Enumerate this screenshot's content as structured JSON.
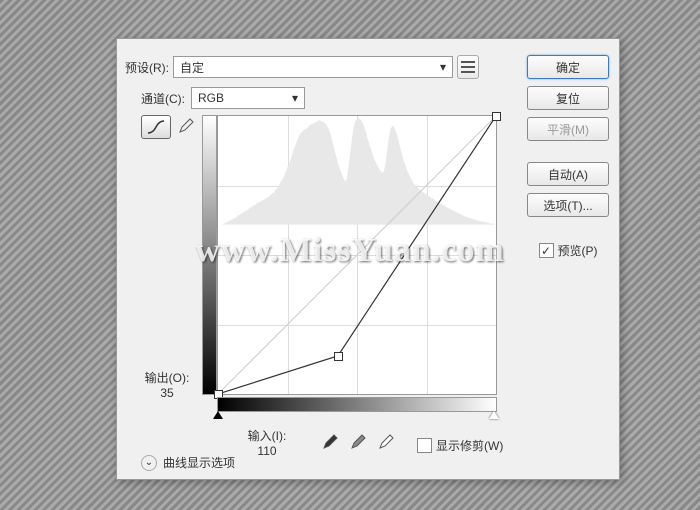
{
  "preset": {
    "label": "预设(R):",
    "value": "自定"
  },
  "channel": {
    "label": "通道(C):",
    "value": "RGB"
  },
  "output": {
    "label": "输出(O):",
    "value": "35"
  },
  "input": {
    "label": "输入(I):",
    "value": "110"
  },
  "clip": {
    "label": "显示修剪(W)",
    "checked": false
  },
  "disclosure": "曲线显示选项",
  "buttons": {
    "ok": "确定",
    "reset": "复位",
    "smooth": "平滑(M)",
    "auto": "自动(A)",
    "options": "选项(T)..."
  },
  "preview": {
    "label": "预览(P)",
    "checked": true
  },
  "icons": {
    "curve": "curve-tool-icon",
    "pencil": "pencil-tool-icon",
    "menu": "preset-menu-icon",
    "dropB": "black-point-dropper",
    "dropG": "gray-point-dropper",
    "dropW": "white-point-dropper"
  },
  "watermark": "www.MissYuan.com",
  "chart_data": {
    "type": "curve",
    "xlim": [
      0,
      255
    ],
    "ylim": [
      0,
      255
    ],
    "points": [
      {
        "x": 0,
        "y": 0
      },
      {
        "x": 110,
        "y": 35
      },
      {
        "x": 255,
        "y": 255
      }
    ],
    "histogram": [
      0,
      0,
      0,
      0,
      0,
      1,
      1,
      2,
      2,
      3,
      3,
      4,
      4,
      5,
      5,
      6,
      6,
      7,
      8,
      9,
      9,
      10,
      10,
      11,
      12,
      12,
      13,
      13,
      14,
      15,
      16,
      16,
      17,
      18,
      18,
      19,
      20,
      20,
      21,
      21,
      22,
      22,
      23,
      23,
      24,
      25,
      25,
      26,
      27,
      28,
      29,
      29,
      30,
      32,
      33,
      34,
      36,
      38,
      40,
      41,
      43,
      45,
      48,
      50,
      53,
      55,
      58,
      60,
      64,
      66,
      70,
      72,
      75,
      78,
      80,
      82,
      84,
      85,
      86,
      87,
      88,
      88,
      89,
      90,
      91,
      92,
      92,
      93,
      93,
      94,
      94,
      95,
      95,
      96,
      96,
      95,
      95,
      94,
      94,
      93,
      92,
      90,
      88,
      85,
      82,
      78,
      74,
      70,
      66,
      62,
      58,
      55,
      52,
      49,
      46,
      44,
      42,
      40,
      40,
      45,
      52,
      60,
      68,
      76,
      84,
      90,
      94,
      96,
      97,
      98,
      98,
      97,
      96,
      94,
      92,
      89,
      86,
      82,
      78,
      75,
      72,
      69,
      66,
      63,
      60,
      58,
      56,
      54,
      52,
      50,
      49,
      48,
      48,
      50,
      55,
      62,
      70,
      78,
      84,
      88,
      90,
      91,
      90,
      88,
      85,
      82,
      78,
      74,
      70,
      66,
      62,
      59,
      56,
      53,
      50,
      48,
      46,
      44,
      42,
      40,
      38,
      37,
      36,
      35,
      34,
      33,
      32,
      31,
      30,
      30,
      29,
      28,
      28,
      27,
      26,
      26,
      25,
      24,
      24,
      23,
      22,
      22,
      21,
      20,
      20,
      19,
      19,
      18,
      18,
      17,
      16,
      16,
      15,
      15,
      14,
      14,
      13,
      13,
      12,
      12,
      11,
      11,
      10,
      10,
      9,
      9,
      8,
      8,
      7,
      7,
      7,
      6,
      6,
      6,
      5,
      5,
      5,
      4,
      4,
      4,
      4,
      3,
      3,
      3,
      3,
      2,
      2,
      2,
      2,
      2,
      1,
      1,
      1,
      1,
      1,
      0
    ]
  }
}
